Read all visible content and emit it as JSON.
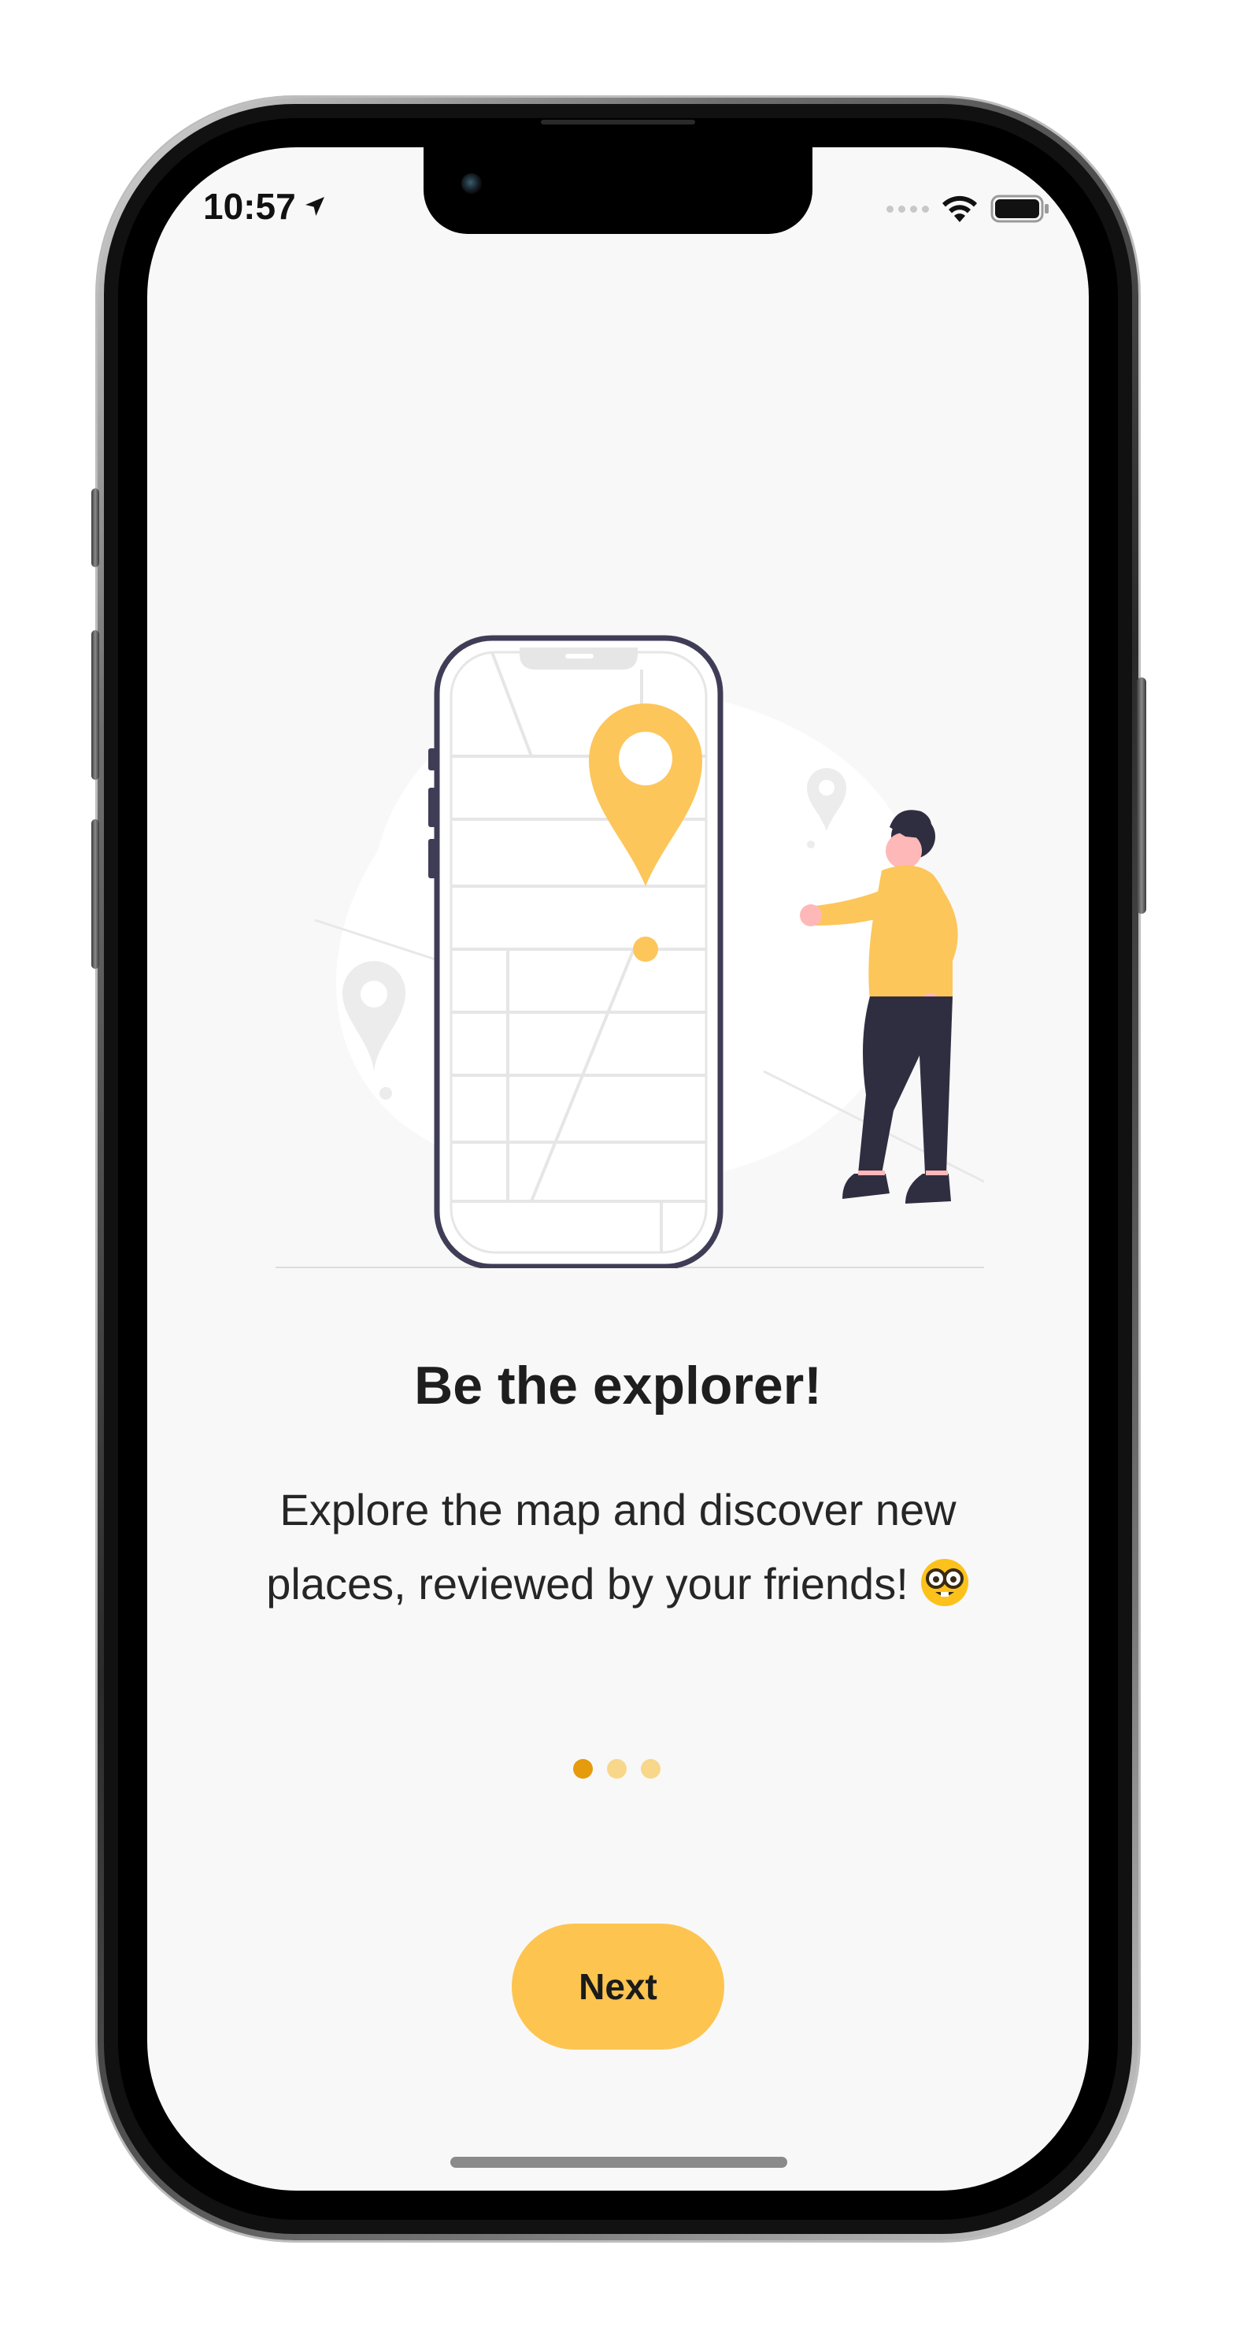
{
  "status_bar": {
    "time": "10:57",
    "location_icon": "location-arrow-icon",
    "signal_icon": "cellular-signal-icon",
    "wifi_icon": "wifi-icon",
    "battery_icon": "battery-full-icon"
  },
  "onboarding": {
    "title": "Be the explorer!",
    "description": "Explore the map and discover new places, reviewed by your friends!",
    "emoji_icon": "nerd-face-emoji-icon",
    "pager": {
      "total_pages": 3,
      "current_page": 1
    },
    "next_label": "Next"
  },
  "colors": {
    "accent": "#fdc44f",
    "dot_active": "#e59b0b",
    "dot_inactive": "#f8d78a",
    "background": "#f8f8f8",
    "text": "#1e1e1e"
  }
}
